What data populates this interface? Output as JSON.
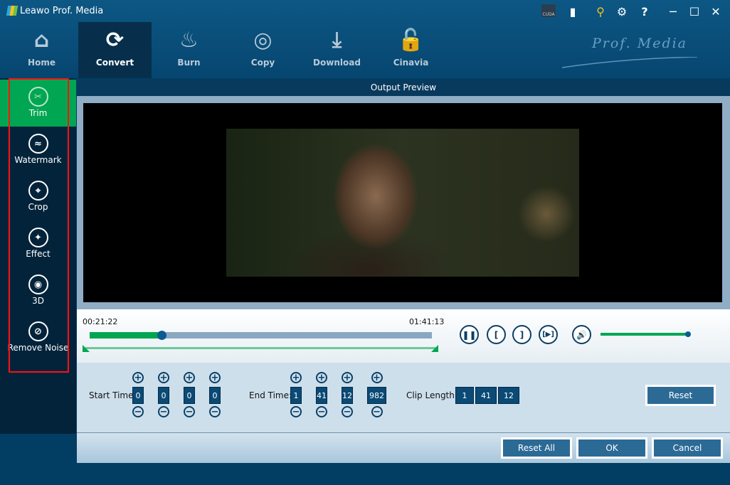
{
  "app": {
    "title": "Leawo Prof. Media",
    "brand": "Prof. Media",
    "cuda": "CUDA"
  },
  "nav": [
    {
      "label": "Home",
      "icon": "home-icon"
    },
    {
      "label": "Convert",
      "icon": "convert-icon"
    },
    {
      "label": "Burn",
      "icon": "burn-icon"
    },
    {
      "label": "Copy",
      "icon": "copy-icon"
    },
    {
      "label": "Download",
      "icon": "download-icon"
    },
    {
      "label": "Cinavia",
      "icon": "cinavia-icon"
    }
  ],
  "sidebar": [
    {
      "label": "Trim",
      "icon": "scissors-icon"
    },
    {
      "label": "Watermark",
      "icon": "watermark-icon"
    },
    {
      "label": "Crop",
      "icon": "crop-icon"
    },
    {
      "label": "Effect",
      "icon": "effect-icon"
    },
    {
      "label": "3D",
      "icon": "3d-glasses-icon"
    },
    {
      "label": "Remove Noise",
      "icon": "remove-noise-icon"
    }
  ],
  "preview": {
    "title": "Output Preview",
    "current_time": "00:21:22",
    "end_time": "01:41:13",
    "progress_percent": 21,
    "volume_percent": 97
  },
  "trim": {
    "start_label": "Start Time:",
    "start": [
      "0",
      "0",
      "0",
      "0"
    ],
    "end_label": "End Time:",
    "end": [
      "1",
      "41",
      "12",
      "982"
    ],
    "clip_label": "Clip Length:",
    "clip": [
      "1",
      "41",
      "12"
    ],
    "reset": "Reset"
  },
  "footer": {
    "reset_all": "Reset All",
    "ok": "OK",
    "cancel": "Cancel"
  }
}
